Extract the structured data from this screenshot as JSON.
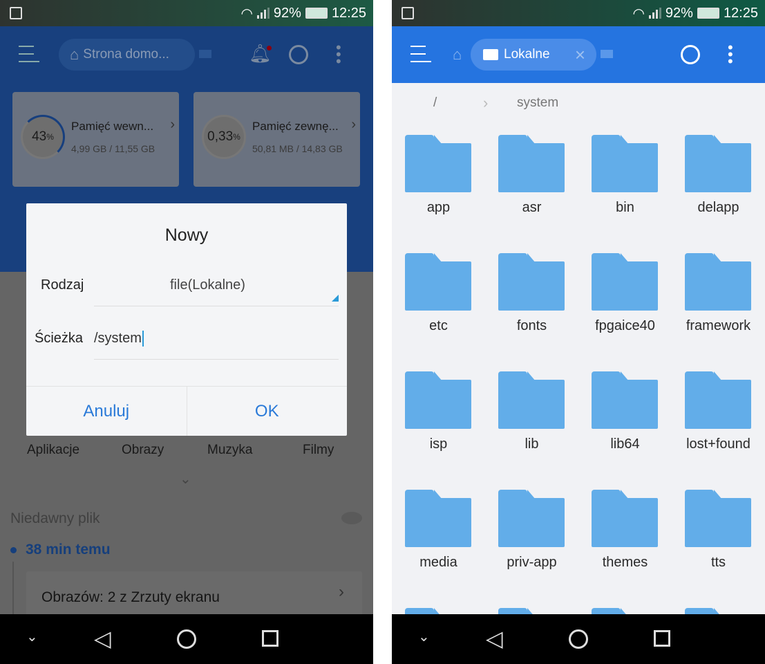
{
  "status": {
    "battery": "92%",
    "time": "12:25"
  },
  "left": {
    "tab_label": "Strona domo...",
    "storage": [
      {
        "percent": "43",
        "unit": "%",
        "name": "Pamięć wewn...",
        "usage": "4,99 GB / 11,55 GB",
        "fill": 0.43
      },
      {
        "percent": "0,33",
        "unit": "%",
        "name": "Pamięć zewnę...",
        "usage": "50,81 MB / 14,83 GB",
        "fill": 0.0033
      }
    ],
    "dialog": {
      "title": "Nowy",
      "type_label": "Rodzaj",
      "type_value": "file(Lokalne)",
      "path_label": "Ścieżka",
      "path_value": "/system",
      "cancel": "Anuluj",
      "ok": "OK"
    },
    "categories": [
      "Aplikacje",
      "Obrazy",
      "Muzyka",
      "Filmy"
    ],
    "recent": {
      "title": "Niedawny plik",
      "time": "38 min temu",
      "item": "Obrazów: 2 z Zrzuty ekranu"
    }
  },
  "right": {
    "tab_label": "Lokalne",
    "breadcrumb": [
      "/",
      "system"
    ],
    "folders": [
      "app",
      "asr",
      "bin",
      "delapp",
      "etc",
      "fonts",
      "fpgaice40",
      "framework",
      "isp",
      "lib",
      "lib64",
      "lost+found",
      "media",
      "priv-app",
      "themes",
      "tts"
    ]
  },
  "colors": {
    "accent": "#2574e0",
    "folder": "#62ade9",
    "dialog_button": "#2a7ad8"
  }
}
